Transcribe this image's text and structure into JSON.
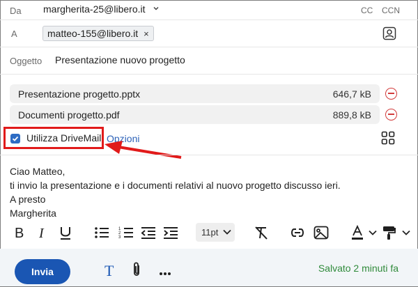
{
  "from": {
    "label": "Da",
    "address": "margherita-25@libero.it"
  },
  "header_links": {
    "cc": "CC",
    "ccn": "CCN"
  },
  "to": {
    "label": "A",
    "recipient": "matteo-155@libero.it",
    "remove": "×"
  },
  "subject": {
    "label": "Oggetto",
    "value": "Presentazione nuovo progetto"
  },
  "attachments": [
    {
      "name": "Presentazione progetto.pptx",
      "size": "646,7 kB"
    },
    {
      "name": "Documenti progetto.pdf",
      "size": "889,8 kB"
    }
  ],
  "drivemail": {
    "label": "Utilizza DriveMail",
    "checked": true,
    "options_link": "Opzioni"
  },
  "message_lines": [
    "Ciao Matteo,",
    "ti invio la presentazione e i documenti relativi al nuovo progetto discusso ieri.",
    "A presto",
    "Margherita"
  ],
  "toolbar": {
    "font_size": "11pt"
  },
  "footer": {
    "send_label": "Invia",
    "saved_status": "Salvato 2 minuti fa"
  },
  "colors": {
    "accent": "#1a56b3",
    "danger": "#d23b3b",
    "saved": "#2f8a3a",
    "annotation": "#e11a1a"
  }
}
